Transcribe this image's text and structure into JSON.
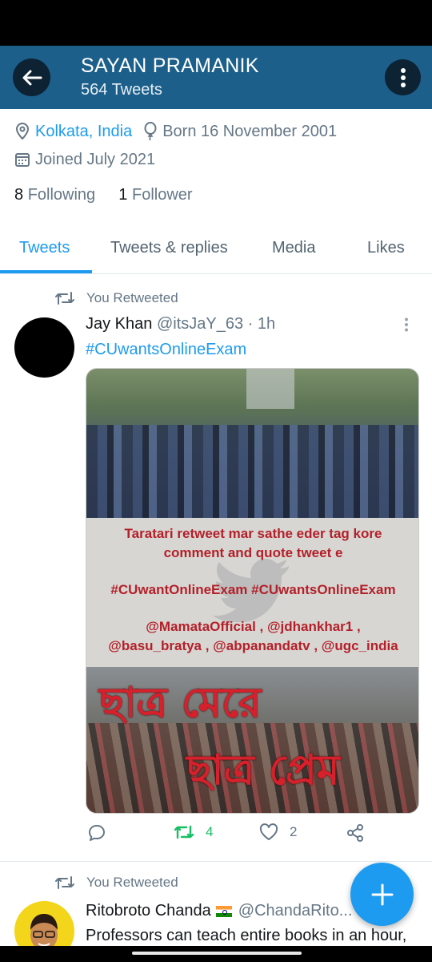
{
  "header": {
    "name": "SAYAN PRAMANIK",
    "tweet_count": "564 Tweets"
  },
  "profile": {
    "location": "Kolkata, India",
    "birthday": "Born 16 November 2001",
    "joined": "Joined July 2021",
    "following_count": "8",
    "following_label": "Following",
    "follower_count": "1",
    "follower_label": "Follower"
  },
  "tabs": [
    {
      "label": "Tweets",
      "active": true
    },
    {
      "label": "Tweets & replies",
      "active": false
    },
    {
      "label": "Media",
      "active": false
    },
    {
      "label": "Likes",
      "active": false
    }
  ],
  "tweets": [
    {
      "retweet_label": "You Retweeted",
      "author": "Jay Khan",
      "handle_time": "@itsJaY_63 · 1h",
      "text": "#CUwantsOnlineExam",
      "media_text": {
        "line1": "Taratari retweet mar sathe eder tag kore",
        "line2": "comment and quote tweet e",
        "line3": "#CUwantOnlineExam #CUwantsOnlineExam",
        "line4": "@MamataOfficial , @jdhankhar1 ,",
        "line5": "@basu_bratya , @abpanandatv , @ugc_india",
        "bengali1": "ছাত্র মেরে",
        "bengali2": "ছাত্র প্রেম"
      },
      "retweets": "4",
      "likes": "2"
    },
    {
      "retweet_label": "You Retweeted",
      "author": "Ritobroto Chanda",
      "handle_time": "@ChandaRito...",
      "text": "Professors can teach entire books in an hour,"
    }
  ],
  "colors": {
    "header_bg": "#1c5f8a",
    "accent": "#1d9bf0",
    "retweet_green": "#17bf63"
  }
}
